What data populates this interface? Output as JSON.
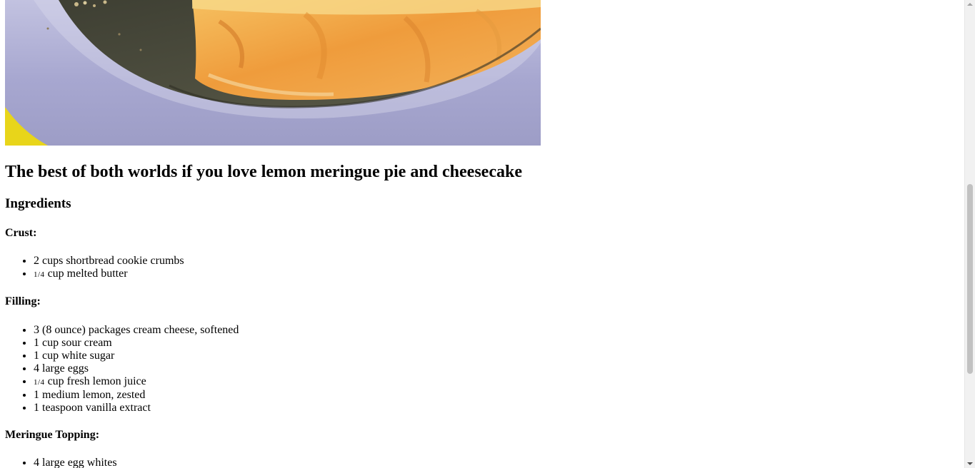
{
  "article": {
    "image_alt": "Lemon meringue cheesecake slice on a plate",
    "title": "The best of both worlds if you love lemon meringue pie and cheesecake",
    "ingredients_heading": "Ingredients",
    "groups": [
      {
        "heading": "Crust:",
        "items": [
          {
            "qty": "2",
            "text": "cups shortbread cookie crumbs"
          },
          {
            "qty": "1/4",
            "text": "cup melted butter"
          }
        ]
      },
      {
        "heading": "Filling:",
        "items": [
          {
            "qty": "3",
            "text": "(8 ounce) packages cream cheese, softened"
          },
          {
            "qty": "1",
            "text": "cup sour cream"
          },
          {
            "qty": "1",
            "text": "cup white sugar"
          },
          {
            "qty": "4",
            "text": "large eggs"
          },
          {
            "qty": "1/4",
            "text": "cup fresh lemon juice"
          },
          {
            "qty": "1",
            "text": "medium lemon, zested"
          },
          {
            "qty": "1",
            "text": "teaspoon vanilla extract"
          }
        ]
      },
      {
        "heading": "Meringue Topping:",
        "items": [
          {
            "qty": "4",
            "text": "large egg whites"
          }
        ]
      }
    ]
  },
  "colors": {
    "plate": "#a9a9cf",
    "pan": "#4a4a3e",
    "cake": "#f0a24a",
    "background": "#ffffff"
  }
}
